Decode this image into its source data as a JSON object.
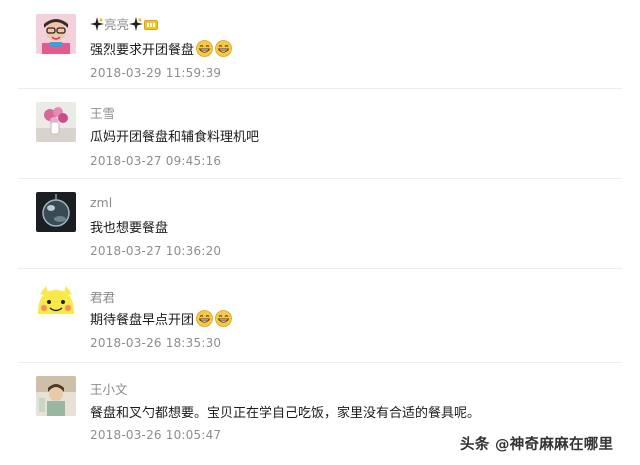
{
  "comments": [
    {
      "name": "亮亮",
      "text": "强烈要求开团餐盘",
      "emoji_count": 2,
      "timestamp": "2018-03-29 11:59:39",
      "name_icons": [
        "sparkle-icon",
        "sparkle-icon",
        "level-badge-icon"
      ]
    },
    {
      "name": "王雪",
      "text": "瓜妈开团餐盘和辅食料理机吧",
      "emoji_count": 0,
      "timestamp": "2018-03-27 09:45:16"
    },
    {
      "name": "zml",
      "text": "我也想要餐盘",
      "emoji_count": 0,
      "timestamp": "2018-03-27 10:36:20"
    },
    {
      "name": "君君",
      "text": "期待餐盘早点开团",
      "emoji_count": 2,
      "timestamp": "2018-03-26 18:35:30"
    },
    {
      "name": "王小文",
      "text": "餐盘和叉勺都想要。宝贝正在学自己吃饭，家里没有合适的餐具呢。",
      "emoji_count": 0,
      "timestamp": "2018-03-26 10:05:47"
    }
  ],
  "emoji": "grinning-face-icon",
  "watermark": {
    "text": "头条 @神奇麻麻在哪里"
  },
  "colors": {
    "name": "#8a8a8a",
    "body": "#1a1a1a",
    "timestamp": "#8e8e8e",
    "emoji_face": "#f7c948"
  }
}
